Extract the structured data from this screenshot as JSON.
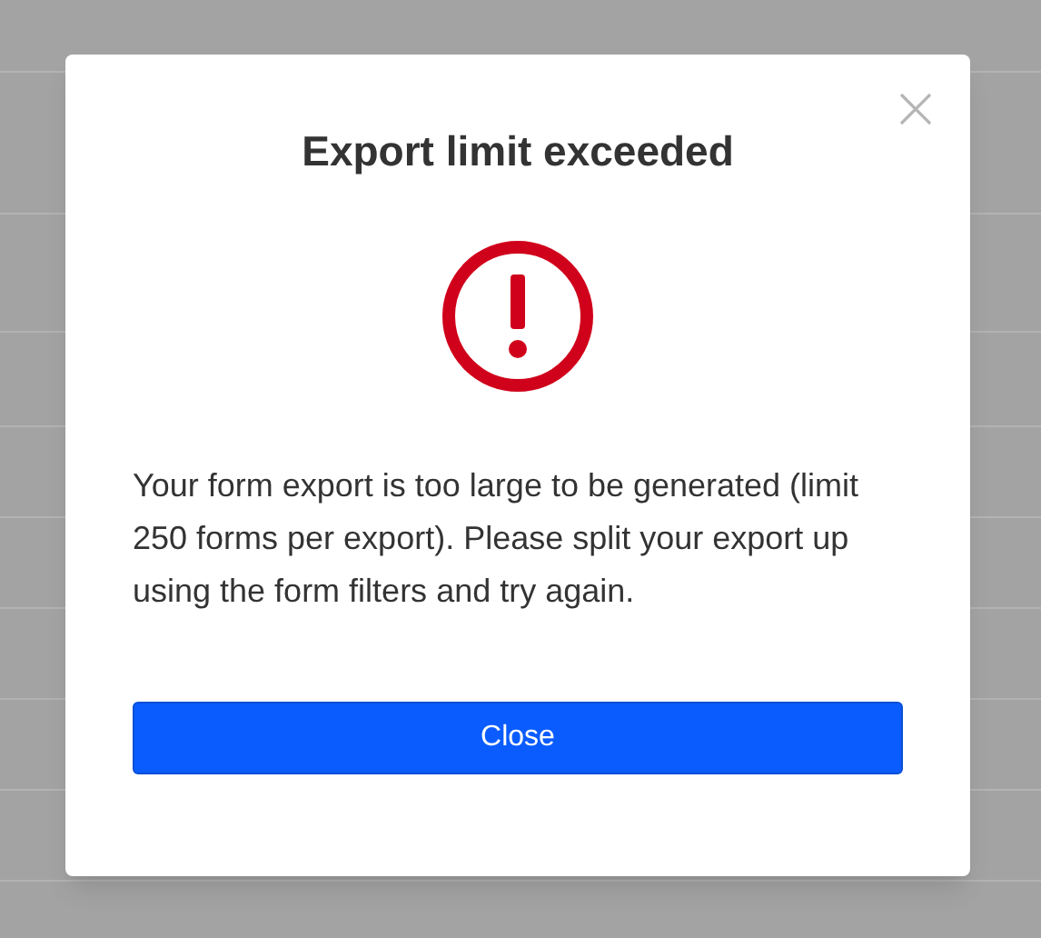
{
  "dialog": {
    "title": "Export limit exceeded",
    "message": "Your form export is too large to be generated (limit 250 forms per export). Please split your export up using the form filters and try again.",
    "button": "Close"
  }
}
